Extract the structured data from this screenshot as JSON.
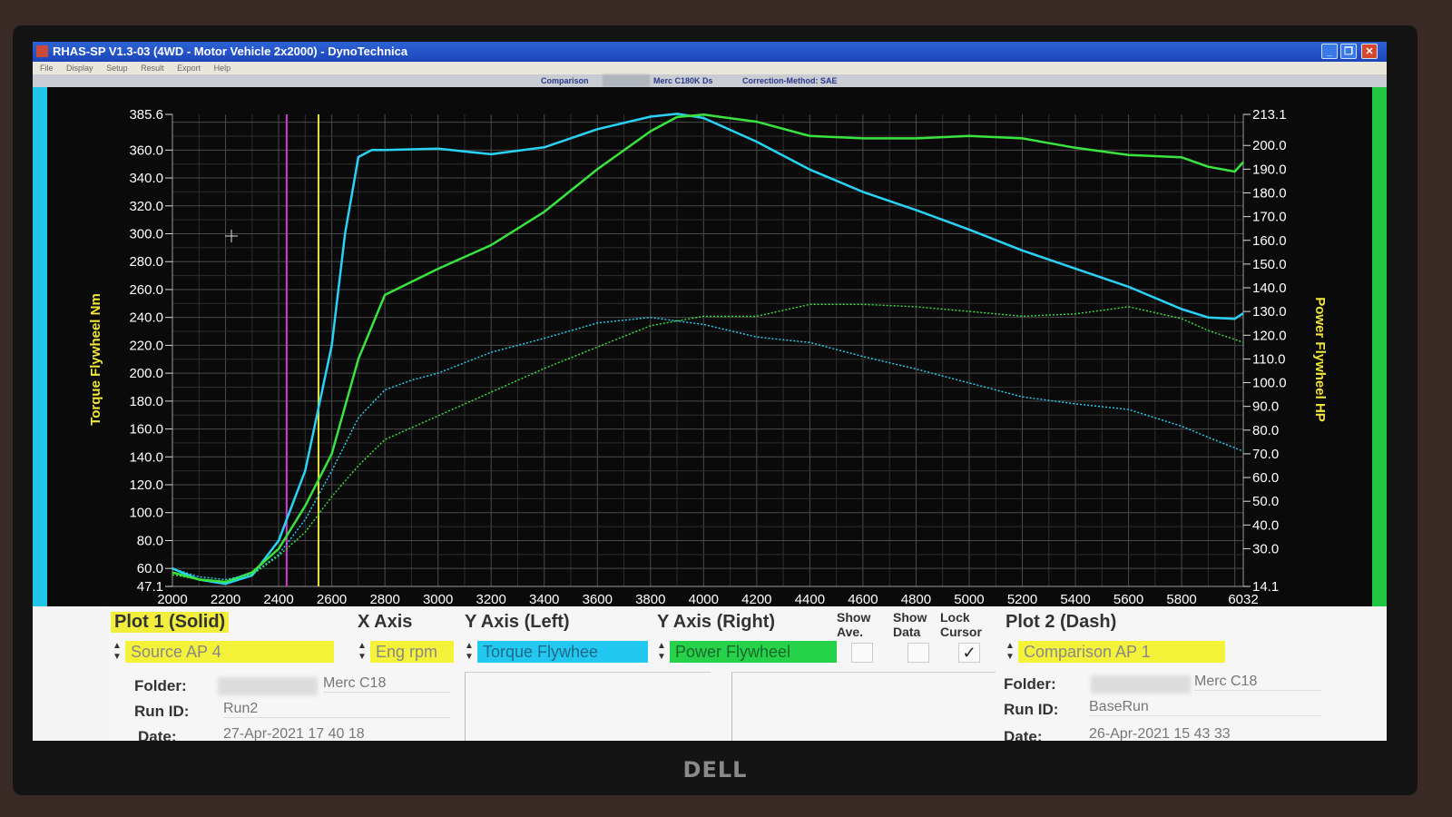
{
  "window": {
    "title": "RHAS-SP V1.3-03  (4WD - Motor Vehicle 2x2000) - DynoTechnica",
    "buttons": [
      "_",
      "❐",
      "✕"
    ]
  },
  "menu": [
    "File",
    "Display",
    "Setup",
    "Result",
    "Export",
    "Help"
  ],
  "info_strip": {
    "comparison": "Comparison",
    "vehicle": "Merc C180K Ds",
    "correction": "Correction-Method: SAE"
  },
  "colors": {
    "torque": "#29d2f5",
    "power": "#39e43e",
    "cursor_magenta": "#d63ad6",
    "cursor_yellow": "#e8e23a",
    "axis_label": "#f0e63c"
  },
  "chart_data": {
    "type": "line",
    "xlabel": "",
    "ylabel_left": "Torque Flywheel Nm",
    "ylabel_right": "Power Flywheel HP",
    "xlim": [
      2000,
      6032
    ],
    "ylim_left": [
      47.1,
      385.6
    ],
    "ylim_right": [
      14.1,
      213.1
    ],
    "x_ticks": [
      "2000",
      "2200",
      "2400",
      "2600",
      "2800",
      "3000",
      "3200",
      "3400",
      "3600",
      "3800",
      "4000",
      "4200",
      "4400",
      "4600",
      "4800",
      "5000",
      "5200",
      "5400",
      "5600",
      "5800",
      "6032"
    ],
    "y_left_ticks": [
      {
        "v": 385.6,
        "t": "385.6"
      },
      {
        "v": 360,
        "t": "360.0"
      },
      {
        "v": 340,
        "t": "340.0"
      },
      {
        "v": 320,
        "t": "320.0"
      },
      {
        "v": 300,
        "t": "300.0"
      },
      {
        "v": 280,
        "t": "280.0"
      },
      {
        "v": 260,
        "t": "260.0"
      },
      {
        "v": 240,
        "t": "240.0"
      },
      {
        "v": 220,
        "t": "220.0"
      },
      {
        "v": 200,
        "t": "200.0"
      },
      {
        "v": 180,
        "t": "180.0"
      },
      {
        "v": 160,
        "t": "160.0"
      },
      {
        "v": 140,
        "t": "140.0"
      },
      {
        "v": 120,
        "t": "120.0"
      },
      {
        "v": 100,
        "t": "100.0"
      },
      {
        "v": 80,
        "t": "80.0"
      },
      {
        "v": 60,
        "t": "60.0"
      },
      {
        "v": 47.1,
        "t": "47.1"
      }
    ],
    "y_right_ticks": [
      {
        "v": 213.1,
        "t": "213.1"
      },
      {
        "v": 200,
        "t": "200.0"
      },
      {
        "v": 190,
        "t": "190.0"
      },
      {
        "v": 180,
        "t": "180.0"
      },
      {
        "v": 170,
        "t": "170.0"
      },
      {
        "v": 160,
        "t": "160.0"
      },
      {
        "v": 150,
        "t": "150.0"
      },
      {
        "v": 140,
        "t": "140.0"
      },
      {
        "v": 130,
        "t": "130.0"
      },
      {
        "v": 120,
        "t": "120.0"
      },
      {
        "v": 110,
        "t": "110.0"
      },
      {
        "v": 100,
        "t": "100.0"
      },
      {
        "v": 90,
        "t": "90.0"
      },
      {
        "v": 80,
        "t": "80.0"
      },
      {
        "v": 70,
        "t": "70.0"
      },
      {
        "v": 60,
        "t": "60.0"
      },
      {
        "v": 50,
        "t": "50.0"
      },
      {
        "v": 40,
        "t": "40.0"
      },
      {
        "v": 30,
        "t": "30.0"
      },
      {
        "v": 14.1,
        "t": "14.1"
      }
    ],
    "cursors": [
      2430,
      2550
    ],
    "grid": true,
    "series": [
      {
        "axis": "left",
        "style": "solid",
        "color": "#29d2f5",
        "x": [
          2000,
          2100,
          2200,
          2300,
          2400,
          2500,
          2600,
          2650,
          2700,
          2750,
          2800,
          3000,
          3200,
          3400,
          3600,
          3800,
          3900,
          4000,
          4200,
          4400,
          4600,
          4800,
          5000,
          5200,
          5400,
          5600,
          5800,
          5900,
          6000,
          6032
        ],
        "y": [
          60,
          52,
          49,
          55,
          80,
          130,
          220,
          300,
          355,
          360,
          360,
          361,
          357,
          362,
          375,
          384,
          386,
          383,
          366,
          346,
          330,
          317,
          303,
          288,
          275,
          262,
          246,
          240,
          239,
          243
        ]
      },
      {
        "axis": "right",
        "style": "solid",
        "color": "#39e43e",
        "x": [
          2000,
          2100,
          2200,
          2300,
          2400,
          2500,
          2600,
          2700,
          2800,
          3000,
          3200,
          3400,
          3600,
          3800,
          3900,
          4000,
          4200,
          4400,
          4600,
          4800,
          5000,
          5200,
          5400,
          5600,
          5800,
          5900,
          6000,
          6032
        ],
        "y": [
          20,
          17,
          16,
          20,
          30,
          48,
          70,
          110,
          137,
          148,
          158,
          172,
          190,
          206,
          212,
          213,
          210,
          204,
          203,
          203,
          204,
          203,
          199,
          196,
          195,
          191,
          189,
          193
        ]
      },
      {
        "axis": "left",
        "style": "dash",
        "color": "#29d2f5",
        "x": [
          2000,
          2100,
          2200,
          2300,
          2400,
          2500,
          2600,
          2700,
          2800,
          2900,
          3000,
          3200,
          3400,
          3600,
          3800,
          4000,
          4200,
          4400,
          4600,
          4800,
          5000,
          5200,
          5400,
          5600,
          5800,
          5900,
          6032
        ],
        "y": [
          60,
          54,
          52,
          56,
          70,
          95,
          130,
          168,
          188,
          195,
          200,
          215,
          225,
          236,
          240,
          235,
          226,
          222,
          212,
          203,
          193,
          183,
          178,
          174,
          162,
          154,
          144
        ]
      },
      {
        "axis": "right",
        "style": "dash",
        "color": "#39e43e",
        "x": [
          2000,
          2100,
          2200,
          2300,
          2400,
          2500,
          2600,
          2700,
          2800,
          3000,
          3200,
          3400,
          3600,
          3800,
          4000,
          4200,
          4400,
          4600,
          4800,
          5000,
          5200,
          5400,
          5600,
          5800,
          5900,
          6032
        ],
        "y": [
          19,
          17,
          16,
          19,
          27,
          37,
          52,
          65,
          76,
          86,
          96,
          106,
          115,
          124,
          128,
          128,
          133,
          133,
          132,
          130,
          128,
          129,
          132,
          127,
          122,
          117
        ]
      }
    ]
  },
  "panel": {
    "plot1_header": "Plot 1 (Solid)",
    "xaxis_header": "X Axis",
    "yleft_header": "Y Axis (Left)",
    "yright_header": "Y Axis (Right)",
    "show_ave": "Show Ave.",
    "show_data": "Show Data",
    "lock_cursor": "Lock Cursor",
    "plot2_header": "Plot 2 (Dash)",
    "source_value": "Source AP 4",
    "xaxis_value": "Eng rpm",
    "yleft_value": "Torque Flywhee",
    "yright_value": "Power Flywheel",
    "comparison_value": "Comparison AP 1",
    "checkmark": "✓",
    "folder_label": "Folder:",
    "runid_label": "Run ID:",
    "date_label": "Date:",
    "plot1_folder": "Merc C18",
    "plot1_runid": "Run2",
    "plot1_date": "27-Apr-2021  17 40 18",
    "plot2_folder": "Merc C18",
    "plot2_runid": "BaseRun",
    "plot2_date": "26-Apr-2021  15 43 33"
  }
}
